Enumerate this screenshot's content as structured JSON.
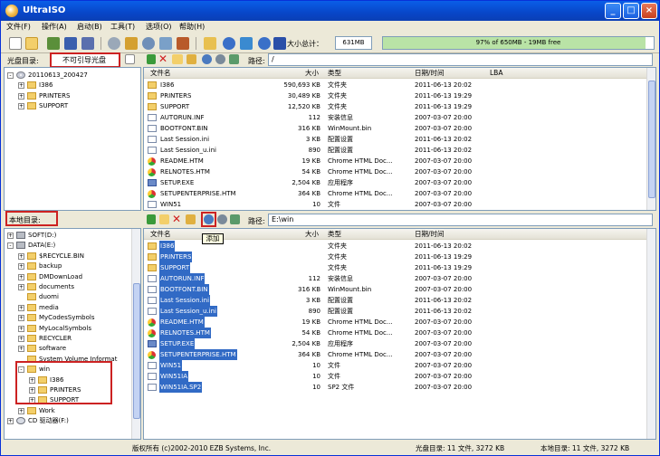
{
  "window": {
    "title": "UltraISO"
  },
  "menu": [
    "文件(F)",
    "操作(A)",
    "启动(B)",
    "工具(T)",
    "选项(O)",
    "帮助(H)"
  ],
  "toolbar": {
    "size_total_label": "大小总计：",
    "size_total_value": "631MB",
    "capacity_text": "97% of 650MB - 19MB free",
    "capacity_percent": 97
  },
  "disc": {
    "label": "光盘目录:",
    "type_value": "不可引导光盘",
    "path_label": "路径:",
    "path_value": "/",
    "tree": [
      {
        "label": "20110613_200427",
        "level": 0,
        "icon": "cd-icon",
        "expander": "-"
      },
      {
        "label": "I386",
        "level": 1,
        "icon": "folder-icon",
        "expander": "+"
      },
      {
        "label": "PRINTERS",
        "level": 1,
        "icon": "folder-icon",
        "expander": "+"
      },
      {
        "label": "SUPPORT",
        "level": 1,
        "icon": "folder-icon",
        "expander": "+"
      }
    ],
    "columns": [
      "文件名",
      "大小",
      "类型",
      "日期/时间",
      "LBA"
    ],
    "files": [
      {
        "name": "I386",
        "size": "590,693 KB",
        "type": "文件夹",
        "date": "2011-06-13 20:02",
        "icon": "folder-icon"
      },
      {
        "name": "PRINTERS",
        "size": "30,489 KB",
        "type": "文件夹",
        "date": "2011-06-13 19:29",
        "icon": "folder-icon"
      },
      {
        "name": "SUPPORT",
        "size": "12,520 KB",
        "type": "文件夹",
        "date": "2011-06-13 19:29",
        "icon": "folder-icon"
      },
      {
        "name": "AUTORUN.INF",
        "size": "112",
        "type": "安装信息",
        "date": "2007-03-07 20:00",
        "icon": "file-icon"
      },
      {
        "name": "BOOTFONT.BIN",
        "size": "316 KB",
        "type": "WinMount.bin",
        "date": "2007-03-07 20:00",
        "icon": "file-icon"
      },
      {
        "name": "Last Session.ini",
        "size": "3 KB",
        "type": "配置设置",
        "date": "2011-06-13 20:02",
        "icon": "file-icon"
      },
      {
        "name": "Last Session_u.ini",
        "size": "890",
        "type": "配置设置",
        "date": "2011-06-13 20:02",
        "icon": "file-icon"
      },
      {
        "name": "README.HTM",
        "size": "19 KB",
        "type": "Chrome HTML Doc...",
        "date": "2007-03-07 20:00",
        "icon": "chrome-icon"
      },
      {
        "name": "RELNOTES.HTM",
        "size": "54 KB",
        "type": "Chrome HTML Doc...",
        "date": "2007-03-07 20:00",
        "icon": "chrome-icon"
      },
      {
        "name": "SETUP.EXE",
        "size": "2,504 KB",
        "type": "应用程序",
        "date": "2007-03-07 20:00",
        "icon": "exe-icon"
      },
      {
        "name": "SETUPENTERPRISE.HTM",
        "size": "364 KB",
        "type": "Chrome HTML Doc...",
        "date": "2007-03-07 20:00",
        "icon": "chrome-icon"
      },
      {
        "name": "WIN51",
        "size": "10",
        "type": "文件",
        "date": "2007-03-07 20:00",
        "icon": "file-icon"
      }
    ]
  },
  "local": {
    "label": "本地目录:",
    "path_label": "路径:",
    "path_value": "E:\\win",
    "tooltip": "添加",
    "tree": [
      {
        "label": "SOFT(D:)",
        "level": 0,
        "icon": "drive-icon",
        "expander": "+"
      },
      {
        "label": "DATA(E:)",
        "level": 0,
        "icon": "drive-icon",
        "expander": "-"
      },
      {
        "label": "$RECYCLE.BIN",
        "level": 1,
        "icon": "folder-icon",
        "expander": "+"
      },
      {
        "label": "backup",
        "level": 1,
        "icon": "folder-icon",
        "expander": "+"
      },
      {
        "label": "DMDownLoad",
        "level": 1,
        "icon": "folder-icon",
        "expander": "+"
      },
      {
        "label": "documents",
        "level": 1,
        "icon": "folder-icon",
        "expander": "+"
      },
      {
        "label": "duomi",
        "level": 1,
        "icon": "folder-icon",
        "expander": ""
      },
      {
        "label": "media",
        "level": 1,
        "icon": "folder-icon",
        "expander": "+"
      },
      {
        "label": "MyCodesSymbols",
        "level": 1,
        "icon": "folder-icon",
        "expander": "+"
      },
      {
        "label": "MyLocalSymbols",
        "level": 1,
        "icon": "folder-icon",
        "expander": "+"
      },
      {
        "label": "RECYCLER",
        "level": 1,
        "icon": "folder-icon",
        "expander": "+"
      },
      {
        "label": "software",
        "level": 1,
        "icon": "folder-icon",
        "expander": "+"
      },
      {
        "label": "System Volume Informat",
        "level": 1,
        "icon": "folder-icon",
        "expander": ""
      },
      {
        "label": "win",
        "level": 1,
        "icon": "folder-icon",
        "expander": "-"
      },
      {
        "label": "I386",
        "level": 2,
        "icon": "folder-icon",
        "expander": "+"
      },
      {
        "label": "PRINTERS",
        "level": 2,
        "icon": "folder-icon",
        "expander": "+"
      },
      {
        "label": "SUPPORT",
        "level": 2,
        "icon": "folder-icon",
        "expander": "+"
      },
      {
        "label": "Work",
        "level": 1,
        "icon": "folder-icon",
        "expander": "+"
      },
      {
        "label": "CD 驱动器(F:)",
        "level": 0,
        "icon": "cd-drive-icon",
        "expander": "+"
      }
    ],
    "columns": [
      "文件名",
      "大小",
      "类型",
      "日期/时间"
    ],
    "files": [
      {
        "name": "I386",
        "size": "",
        "type": "文件夹",
        "date": "2011-06-13 20:02",
        "icon": "folder-icon"
      },
      {
        "name": "PRINTERS",
        "size": "",
        "type": "文件夹",
        "date": "2011-06-13 19:29",
        "icon": "folder-icon"
      },
      {
        "name": "SUPPORT",
        "size": "",
        "type": "文件夹",
        "date": "2011-06-13 19:29",
        "icon": "folder-icon"
      },
      {
        "name": "AUTORUN.INF",
        "size": "112",
        "type": "安装信息",
        "date": "2007-03-07 20:00",
        "icon": "file-icon"
      },
      {
        "name": "BOOTFONT.BIN",
        "size": "316 KB",
        "type": "WinMount.bin",
        "date": "2007-03-07 20:00",
        "icon": "file-icon"
      },
      {
        "name": "Last Session.ini",
        "size": "3 KB",
        "type": "配置设置",
        "date": "2011-06-13 20:02",
        "icon": "file-icon"
      },
      {
        "name": "Last Session_u.ini",
        "size": "890",
        "type": "配置设置",
        "date": "2011-06-13 20:02",
        "icon": "file-icon"
      },
      {
        "name": "README.HTM",
        "size": "19 KB",
        "type": "Chrome HTML Doc...",
        "date": "2007-03-07 20:00",
        "icon": "chrome-icon"
      },
      {
        "name": "RELNOTES.HTM",
        "size": "54 KB",
        "type": "Chrome HTML Doc...",
        "date": "2007-03-07 20:00",
        "icon": "chrome-icon"
      },
      {
        "name": "SETUP.EXE",
        "size": "2,504 KB",
        "type": "应用程序",
        "date": "2007-03-07 20:00",
        "icon": "exe-icon"
      },
      {
        "name": "SETUPENTERPRISE.HTM",
        "size": "364 KB",
        "type": "Chrome HTML Doc...",
        "date": "2007-03-07 20:00",
        "icon": "chrome-icon"
      },
      {
        "name": "WIN51",
        "size": "10",
        "type": "文件",
        "date": "2007-03-07 20:00",
        "icon": "file-icon"
      },
      {
        "name": "WIN51IA",
        "size": "10",
        "type": "文件",
        "date": "2007-03-07 20:00",
        "icon": "file-icon"
      },
      {
        "name": "WIN51IA.SP2",
        "size": "10",
        "type": "SP2 文件",
        "date": "2007-03-07 20:00",
        "icon": "file-icon"
      }
    ]
  },
  "status": {
    "copyright": "版权所有 (c)2002-2010 EZB Systems, Inc.",
    "disc_summary": "光盘目录: 11 文件, 3272 KB",
    "local_summary": "本地目录: 11 文件, 3272 KB"
  },
  "colors": {
    "selection": "#316ac5",
    "title_bar": "#0846c8",
    "annotation_red": "#cc2222"
  }
}
